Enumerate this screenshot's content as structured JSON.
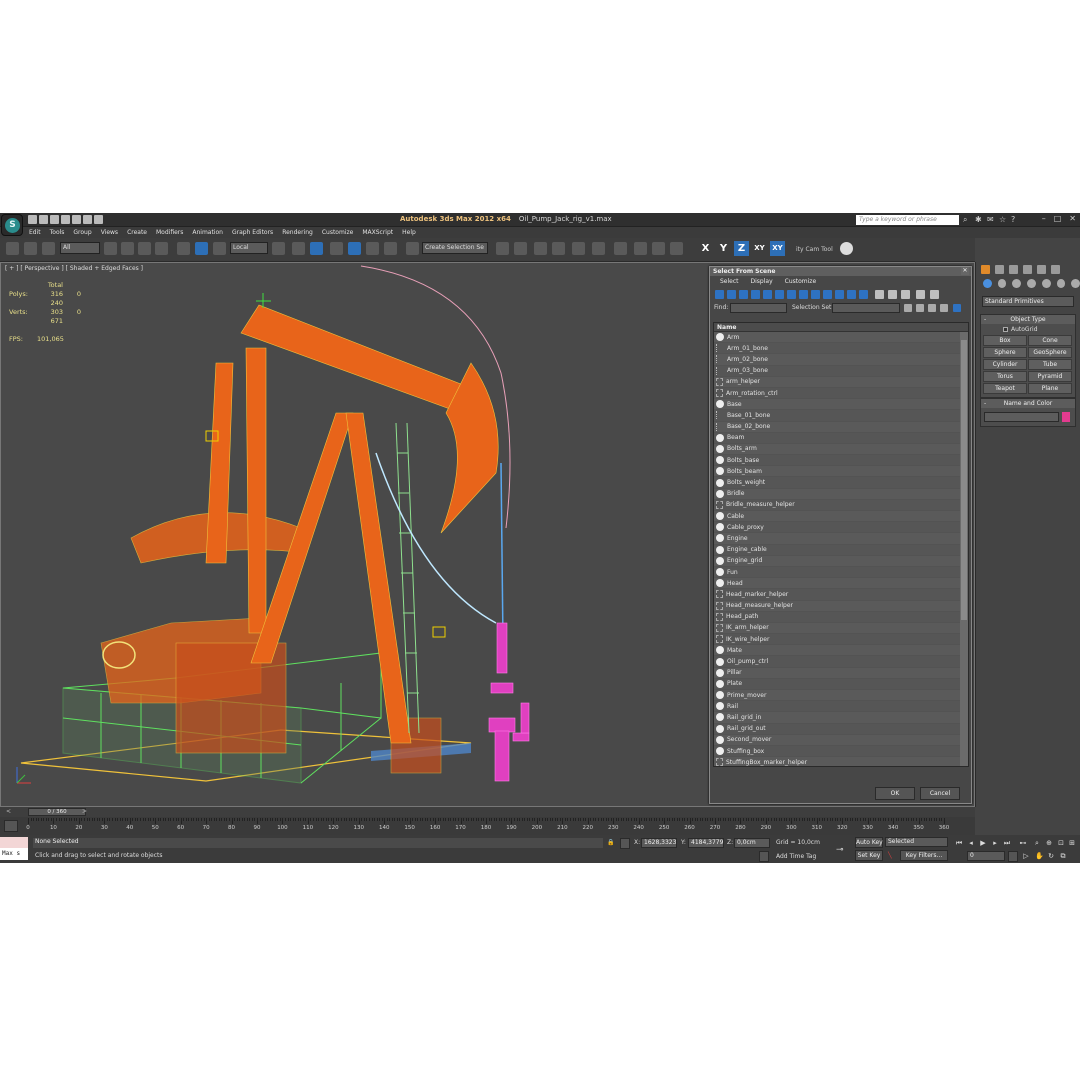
{
  "app": {
    "title": "Autodesk 3ds Max  2012 x64",
    "file": "Oil_Pump_Jack_rig_v1.max",
    "logo": "3ds-max-logo",
    "logo_text": "S",
    "search_placeholder": "Type a keyword or phrase"
  },
  "menu": [
    "Edit",
    "Tools",
    "Group",
    "Views",
    "Create",
    "Modifiers",
    "Animation",
    "Graph Editors",
    "Rendering",
    "Customize",
    "MAXScript",
    "Help"
  ],
  "toolbar": {
    "filter_value": "All",
    "refcoord_value": "Local",
    "selection_set_placeholder": "Create Selection Se",
    "axis_x": "X",
    "axis_y": "Y",
    "axis_z": "Z",
    "axis_xy": "XY",
    "axis_xy2": "XY",
    "cam_tool": "ity Cam Tool"
  },
  "viewport": {
    "label": "[ + ] [ Perspective ] [ Shaded + Edged Faces ]",
    "stats": {
      "total_label": "Total",
      "polys_label": "Polys:",
      "polys_total": "316 240",
      "polys_sel": "0",
      "verts_label": "Verts:",
      "verts_total": "303 671",
      "verts_sel": "0",
      "fps_label": "FPS:",
      "fps_value": "101,065"
    },
    "scene_colors": {
      "pumpjack": "#e8641a",
      "frame": "#f0c23a",
      "fence": "#5fe05f",
      "wellhead": "#e040c0",
      "ladder": "#8ee08e"
    }
  },
  "dialog": {
    "title": "Select From Scene",
    "menu": [
      "Select",
      "Display",
      "Customize"
    ],
    "find_label": "Find:",
    "selection_set_label": "Selection Set:",
    "column_name": "Name",
    "items": [
      {
        "name": "Arm",
        "icon": "object"
      },
      {
        "name": "Arm_01_bone",
        "icon": "bone"
      },
      {
        "name": "Arm_02_bone",
        "icon": "bone"
      },
      {
        "name": "Arm_03_bone",
        "icon": "bone"
      },
      {
        "name": "arm_helper",
        "icon": "helper"
      },
      {
        "name": "Arm_rotation_ctrl",
        "icon": "helper"
      },
      {
        "name": "Base",
        "icon": "object"
      },
      {
        "name": "Base_01_bone",
        "icon": "bone"
      },
      {
        "name": "Base_02_bone",
        "icon": "bone"
      },
      {
        "name": "Beam",
        "icon": "object"
      },
      {
        "name": "Bolts_arm",
        "icon": "object"
      },
      {
        "name": "Bolts_base",
        "icon": "object"
      },
      {
        "name": "Bolts_beam",
        "icon": "object"
      },
      {
        "name": "Bolts_weight",
        "icon": "object"
      },
      {
        "name": "Bridle",
        "icon": "object"
      },
      {
        "name": "Bridle_measure_helper",
        "icon": "helper"
      },
      {
        "name": "Cable",
        "icon": "object"
      },
      {
        "name": "Cable_proxy",
        "icon": "object"
      },
      {
        "name": "Engine",
        "icon": "object"
      },
      {
        "name": "Engine_cable",
        "icon": "object"
      },
      {
        "name": "Engine_grid",
        "icon": "object"
      },
      {
        "name": "Fun",
        "icon": "object"
      },
      {
        "name": "Head",
        "icon": "object"
      },
      {
        "name": "Head_marker_helper",
        "icon": "helper"
      },
      {
        "name": "Head_measure_helper",
        "icon": "helper"
      },
      {
        "name": "Head_path",
        "icon": "helper"
      },
      {
        "name": "IK_arm_helper",
        "icon": "helper"
      },
      {
        "name": "IK_wire_helper",
        "icon": "helper"
      },
      {
        "name": "Mate",
        "icon": "object"
      },
      {
        "name": "Oil_pump_ctrl",
        "icon": "object"
      },
      {
        "name": "Pillar",
        "icon": "object"
      },
      {
        "name": "Plate",
        "icon": "object"
      },
      {
        "name": "Prime_mover",
        "icon": "object"
      },
      {
        "name": "Rail",
        "icon": "object"
      },
      {
        "name": "Rail_grid_in",
        "icon": "object"
      },
      {
        "name": "Rail_grid_out",
        "icon": "object"
      },
      {
        "name": "Second_mover",
        "icon": "object"
      },
      {
        "name": "Stuffing_box",
        "icon": "object"
      },
      {
        "name": "StuffingBox_marker_helper",
        "icon": "helper"
      }
    ],
    "ok_label": "OK",
    "cancel_label": "Cancel"
  },
  "command_panel": {
    "category": "Standard Primitives",
    "object_type_title": "Object Type",
    "autogrid_label": "AutoGrid",
    "buttons": [
      "Box",
      "Cone",
      "Sphere",
      "GeoSphere",
      "Cylinder",
      "Tube",
      "Torus",
      "Pyramid",
      "Teapot",
      "Plane"
    ],
    "name_color_title": "Name and Color",
    "color": "#e33b8f"
  },
  "timeline": {
    "frame_label": "0 / 360",
    "ticks": [
      "0",
      "10",
      "20",
      "30",
      "40",
      "50",
      "60",
      "70",
      "80",
      "90",
      "100",
      "110",
      "120",
      "130",
      "140",
      "150",
      "160",
      "170",
      "180",
      "190",
      "200",
      "210",
      "220",
      "230",
      "240",
      "250",
      "260",
      "270",
      "280",
      "290",
      "300",
      "310",
      "320",
      "330",
      "340",
      "350",
      "360"
    ]
  },
  "status": {
    "maxscript_label": "Max s",
    "selection": "None Selected",
    "prompt": "Click and drag to select and rotate objects",
    "x_label": "X:",
    "x_value": "1628,3323",
    "y_label": "Y:",
    "y_value": "4184,3779",
    "z_label": "Z:",
    "z_value": "0,0cm",
    "grid": "Grid = 10,0cm",
    "add_time_tag": "Add Time Tag",
    "auto_key": "Auto Key",
    "set_key": "Set Key",
    "key_mode": "Selected",
    "key_filters": "Key Filters...",
    "current_frame": "0"
  }
}
